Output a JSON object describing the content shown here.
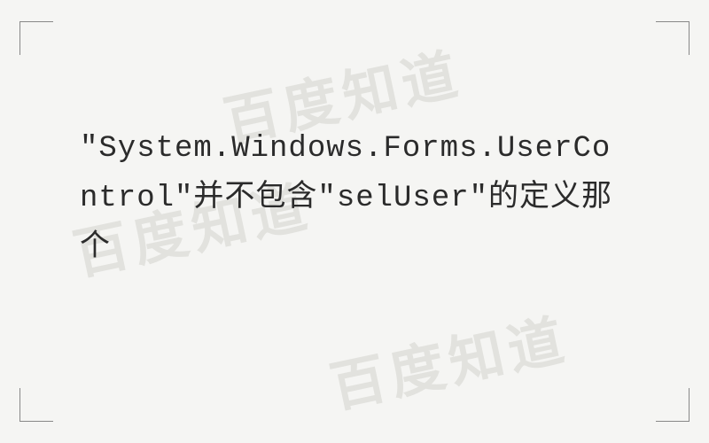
{
  "watermark": "百度知道",
  "text": "\"System.Windows.Forms.UserControl\"并不包含\"selUser\"的定义那个"
}
